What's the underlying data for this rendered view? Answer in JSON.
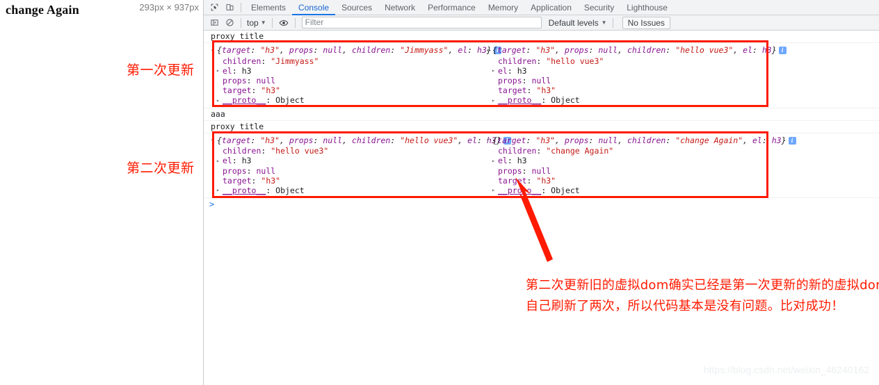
{
  "page_pane": {
    "title": "change Again",
    "size_badge": "293px × 937px",
    "annotation_first": "第一次更新",
    "annotation_second": "第二次更新"
  },
  "devtools": {
    "icons": {
      "inspect": "inspect-element-icon",
      "device": "device-toolbar-icon",
      "sidebar": "console-sidebar-icon",
      "clear": "clear-console-icon",
      "eye": "live-expression-eye-icon"
    },
    "tabs": [
      {
        "label": "Elements",
        "active": false
      },
      {
        "label": "Console",
        "active": true
      },
      {
        "label": "Sources",
        "active": false
      },
      {
        "label": "Network",
        "active": false
      },
      {
        "label": "Performance",
        "active": false
      },
      {
        "label": "Memory",
        "active": false
      },
      {
        "label": "Application",
        "active": false
      },
      {
        "label": "Security",
        "active": false
      },
      {
        "label": "Lighthouse",
        "active": false
      }
    ],
    "context_selector": "top",
    "filter_placeholder": "Filter",
    "filter_value": "",
    "levels_selector": "Default levels",
    "issues_button": "No Issues",
    "caret": "▼"
  },
  "console": {
    "prompt": ">",
    "rows": [
      {
        "kind": "log",
        "text": "proxy title"
      },
      {
        "kind": "object_pair",
        "left": {
          "preview_children": "Jimmyass",
          "preview_target": "h3",
          "preview_props": "null",
          "preview_el": "h3",
          "props": [
            {
              "key": "children",
              "val": "\"Jimmyass\"",
              "type": "str",
              "expandable": false
            },
            {
              "key": "el",
              "val": "h3",
              "type": "plain",
              "expandable": true
            },
            {
              "key": "props",
              "val": "null",
              "type": "null",
              "expandable": false
            },
            {
              "key": "target",
              "val": "\"h3\"",
              "type": "str",
              "expandable": false
            },
            {
              "key": "__proto__",
              "val": "Object",
              "type": "proto",
              "expandable": true
            }
          ]
        },
        "right": {
          "preview_children": "hello vue3",
          "preview_target": "h3",
          "preview_props": "null",
          "preview_el": "h3",
          "props": [
            {
              "key": "children",
              "val": "\"hello vue3\"",
              "type": "str",
              "expandable": false
            },
            {
              "key": "el",
              "val": "h3",
              "type": "plain",
              "expandable": true
            },
            {
              "key": "props",
              "val": "null",
              "type": "null",
              "expandable": false
            },
            {
              "key": "target",
              "val": "\"h3\"",
              "type": "str",
              "expandable": false
            },
            {
              "key": "__proto__",
              "val": "Object",
              "type": "proto",
              "expandable": true
            }
          ]
        }
      },
      {
        "kind": "log",
        "text": "aaa"
      },
      {
        "kind": "log",
        "text": "proxy title"
      },
      {
        "kind": "object_pair",
        "left": {
          "preview_children": "hello vue3",
          "preview_target": "h3",
          "preview_props": "null",
          "preview_el": "h3",
          "props": [
            {
              "key": "children",
              "val": "\"hello vue3\"",
              "type": "str",
              "expandable": false
            },
            {
              "key": "el",
              "val": "h3",
              "type": "plain",
              "expandable": true
            },
            {
              "key": "props",
              "val": "null",
              "type": "null",
              "expandable": false
            },
            {
              "key": "target",
              "val": "\"h3\"",
              "type": "str",
              "expandable": false
            },
            {
              "key": "__proto__",
              "val": "Object",
              "type": "proto",
              "expandable": true
            }
          ]
        },
        "right": {
          "preview_children": "change Again",
          "preview_target": "h3",
          "preview_props": "null",
          "preview_el": "h3",
          "props": [
            {
              "key": "children",
              "val": "\"change Again\"",
              "type": "str",
              "expandable": false
            },
            {
              "key": "el",
              "val": "h3",
              "type": "plain",
              "expandable": true
            },
            {
              "key": "props",
              "val": "null",
              "type": "null",
              "expandable": false
            },
            {
              "key": "target",
              "val": "\"h3\"",
              "type": "str",
              "expandable": false
            },
            {
              "key": "__proto__",
              "val": "Object",
              "type": "proto",
              "expandable": true
            }
          ]
        }
      }
    ]
  },
  "annotations": {
    "bottom_note_line1": "第二次更新旧的虚拟dom确实已经是第一次更新的新的虚拟dom了，并且页面也",
    "bottom_note_line2": "自己刷新了两次，所以代码基本是没有问题。比对成功！",
    "watermark": "https://blog.csdn.net/weixin_46240162"
  },
  "colors": {
    "red_accent": "#ff1a00",
    "tab_active": "#1a73e8",
    "string_red": "#c41a16",
    "prop_purple": "#881391"
  }
}
